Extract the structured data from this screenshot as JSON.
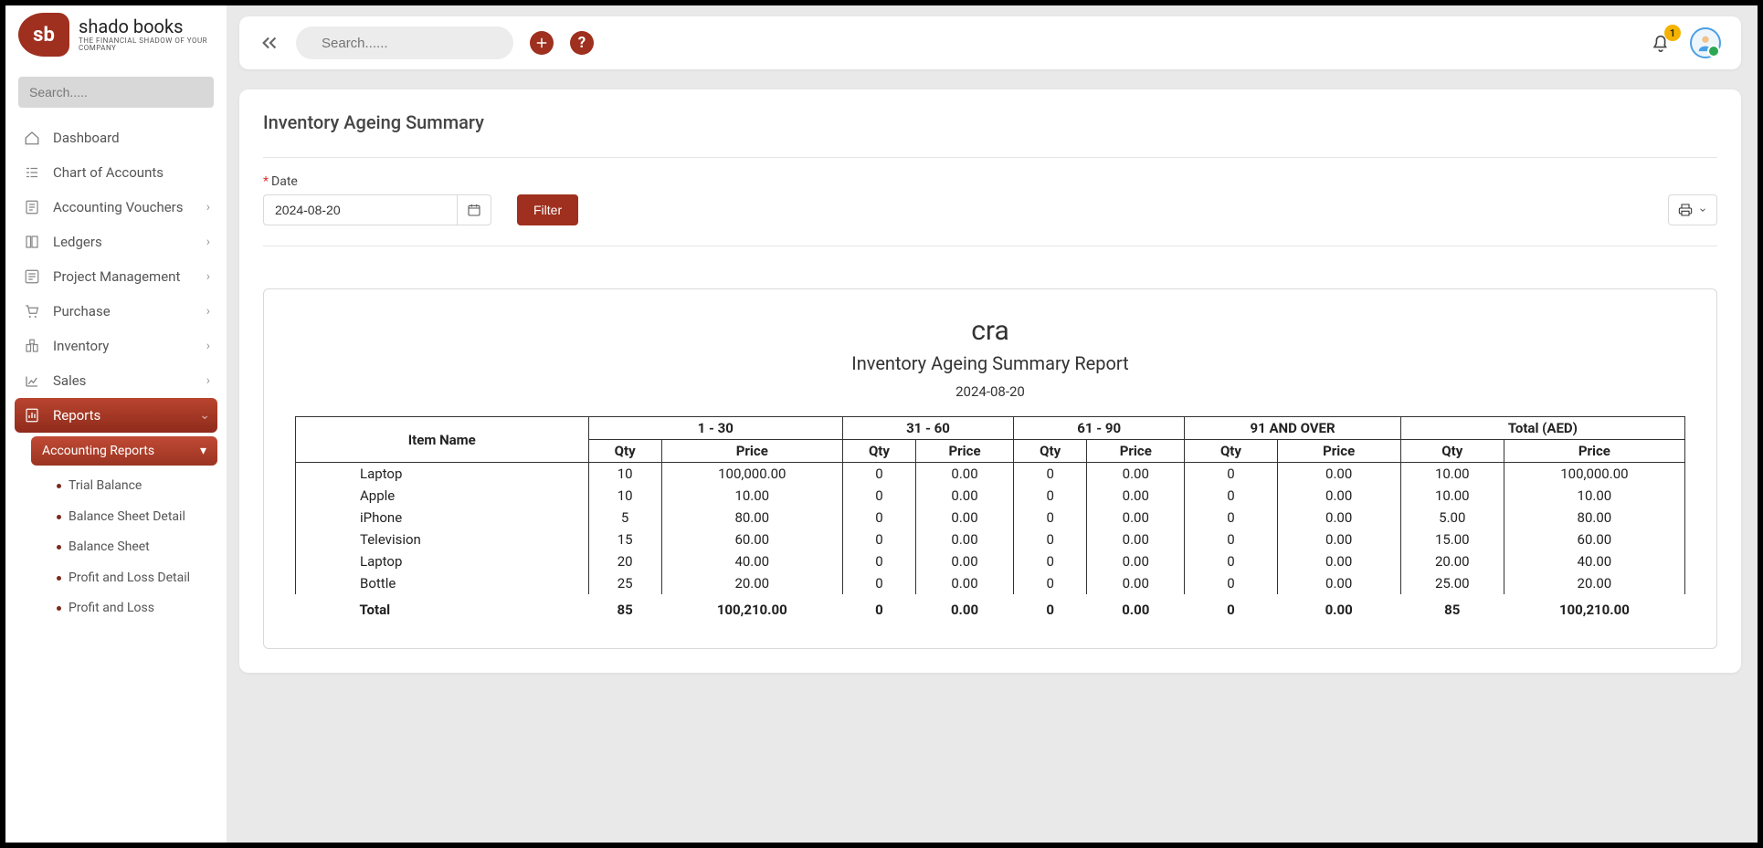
{
  "brand": {
    "sb": "sb",
    "name": "shado books",
    "tagline": "THE FINANCIAL SHADOW OF YOUR COMPANY"
  },
  "sidebar": {
    "search_placeholder": "Search.....",
    "items": [
      {
        "label": "Dashboard"
      },
      {
        "label": "Chart of Accounts"
      },
      {
        "label": "Accounting Vouchers",
        "chevron": true
      },
      {
        "label": "Ledgers",
        "chevron": true
      },
      {
        "label": "Project Management",
        "chevron": true
      },
      {
        "label": "Purchase",
        "chevron": true
      },
      {
        "label": "Inventory",
        "chevron": true
      },
      {
        "label": "Sales",
        "chevron": true
      },
      {
        "label": "Reports",
        "active": true,
        "chevron": true
      }
    ],
    "submenu": {
      "head": "Accounting Reports",
      "items": [
        "Trial Balance",
        "Balance Sheet Detail",
        "Balance Sheet",
        "Profit and Loss Detail",
        "Profit and Loss"
      ]
    }
  },
  "topbar": {
    "search_placeholder": "Search......",
    "notification_count": "1"
  },
  "page": {
    "title": "Inventory Ageing Summary",
    "date_label": "Date",
    "date_value": "2024-08-20",
    "filter_label": "Filter"
  },
  "report": {
    "company": "cra",
    "title": "Inventory Ageing Summary Report",
    "date": "2024-08-20",
    "header_groups": [
      "Item Name",
      "1 - 30",
      "31 - 60",
      "61 - 90",
      "91 AND OVER",
      "Total (AED)"
    ],
    "sub_headers": [
      "Qty",
      "Price"
    ],
    "rows": [
      {
        "name": "Laptop",
        "c": [
          "10",
          "100,000.00",
          "0",
          "0.00",
          "0",
          "0.00",
          "0",
          "0.00",
          "10.00",
          "100,000.00"
        ]
      },
      {
        "name": "Apple",
        "c": [
          "10",
          "10.00",
          "0",
          "0.00",
          "0",
          "0.00",
          "0",
          "0.00",
          "10.00",
          "10.00"
        ]
      },
      {
        "name": "iPhone",
        "c": [
          "5",
          "80.00",
          "0",
          "0.00",
          "0",
          "0.00",
          "0",
          "0.00",
          "5.00",
          "80.00"
        ]
      },
      {
        "name": "Television",
        "c": [
          "15",
          "60.00",
          "0",
          "0.00",
          "0",
          "0.00",
          "0",
          "0.00",
          "15.00",
          "60.00"
        ]
      },
      {
        "name": "Laptop",
        "c": [
          "20",
          "40.00",
          "0",
          "0.00",
          "0",
          "0.00",
          "0",
          "0.00",
          "20.00",
          "40.00"
        ]
      },
      {
        "name": "Bottle",
        "c": [
          "25",
          "20.00",
          "0",
          "0.00",
          "0",
          "0.00",
          "0",
          "0.00",
          "25.00",
          "20.00"
        ]
      }
    ],
    "total_label": "Total",
    "totals": [
      "85",
      "100,210.00",
      "0",
      "0.00",
      "0",
      "0.00",
      "0",
      "0.00",
      "85",
      "100,210.00"
    ]
  }
}
